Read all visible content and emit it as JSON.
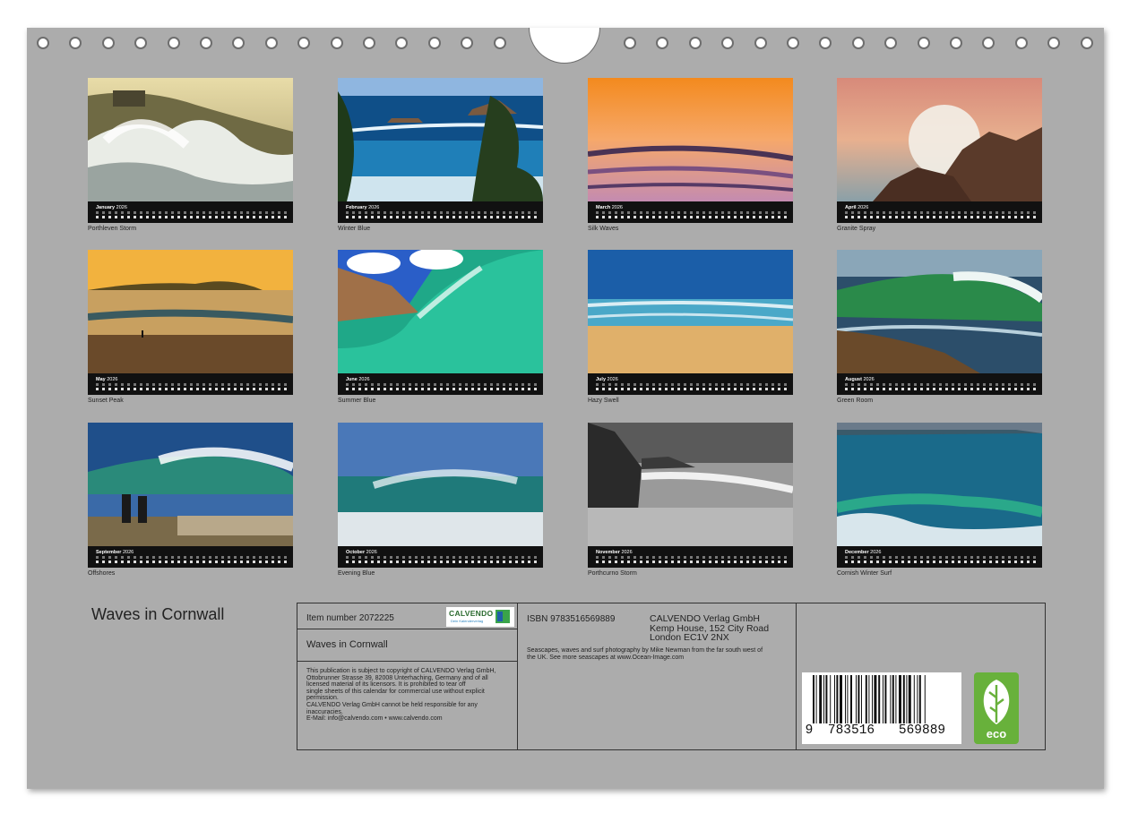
{
  "months": [
    {
      "month": "January",
      "year": "2026",
      "caption": "Porthleven Storm"
    },
    {
      "month": "February",
      "year": "2026",
      "caption": "Winter Blue"
    },
    {
      "month": "March",
      "year": "2026",
      "caption": "Silk Waves"
    },
    {
      "month": "April",
      "year": "2026",
      "caption": "Granite Spray"
    },
    {
      "month": "May",
      "year": "2026",
      "caption": "Sunset Peak"
    },
    {
      "month": "June",
      "year": "2026",
      "caption": "Summer Blue"
    },
    {
      "month": "July",
      "year": "2026",
      "caption": "Hazy Swell"
    },
    {
      "month": "August",
      "year": "2026",
      "caption": "Green Room"
    },
    {
      "month": "September",
      "year": "2026",
      "caption": "Offshores"
    },
    {
      "month": "October",
      "year": "2026",
      "caption": "Evening Blue"
    },
    {
      "month": "November",
      "year": "2026",
      "caption": "Porthcurno Storm"
    },
    {
      "month": "December",
      "year": "2026",
      "caption": "Cornish Winter Surf"
    }
  ],
  "title": "Waves in Cornwall",
  "info": {
    "item_number": "Item number 2072225",
    "logo_text": "CALVENDO",
    "logo_subtext": "Dein Kalenderverlag",
    "title": "Waves in Cornwall",
    "copyright_lines": [
      "This publication is subject to copyright of CALVENDO Verlag GmbH,",
      "Ottobrunner Strasse 39, 82008 Unterhaching, Germany and of all",
      "licensed material of its licensors. It is prohibited to tear off",
      "single sheets of this calendar for commercial use without explicit",
      "permission.",
      "CALVENDO Verlag GmbH cannot be held responsible for any",
      "inaccuracies.",
      "E-Mail: info@calvendo.com • www.calvendo.com"
    ],
    "isbn": "ISBN 9783516569889",
    "publisher_lines": [
      "CALVENDO Verlag GmbH",
      "Kemp House, 152 City Road",
      "London EC1V 2NX"
    ],
    "description_lines": [
      "Seascapes, waves and surf photography by Mike Newman from the far south west of",
      "the UK. See more seascapes at www.Ocean-Image.com"
    ],
    "barcode_digits": [
      "9",
      "783516",
      "569889"
    ],
    "eco_label": "eco"
  },
  "colors": {
    "page_background": "#acacac",
    "calendar_strip": "#111111",
    "eco_green": "#68b13b",
    "logo_green": "#2a6a2e"
  },
  "icons": [
    "binding-ring-icon",
    "hanger-notch-icon",
    "calvendo-logo-icon",
    "barcode-icon",
    "eco-leaf-icon"
  ]
}
